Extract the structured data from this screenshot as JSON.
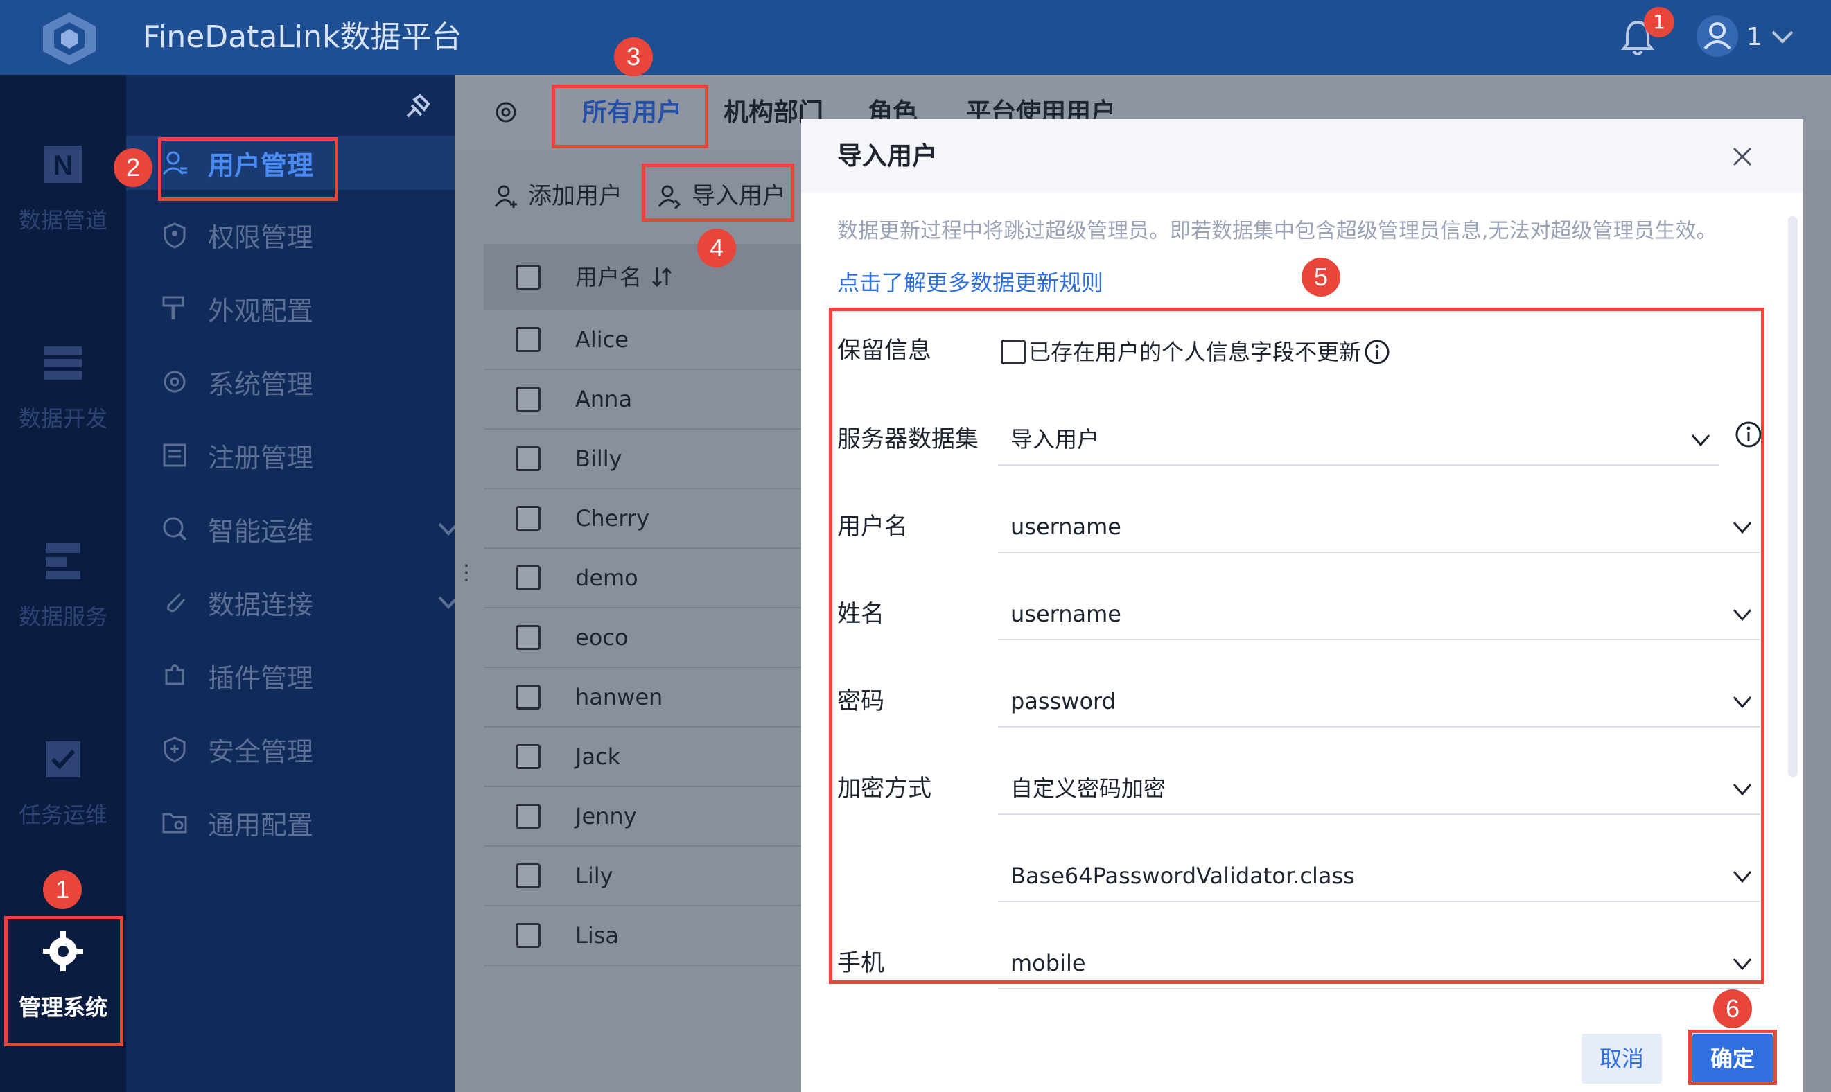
{
  "app": {
    "title": "FineDataLink数据平台",
    "notification_count": "1",
    "user": "1",
    "colors": {
      "header": "#1f4f93",
      "accent": "#2f6fe0",
      "highlight": "#e8463a"
    }
  },
  "leftnav": {
    "items": [
      {
        "label": "数据管道",
        "icon": "pipeline-icon"
      },
      {
        "label": "数据开发",
        "icon": "dev-icon"
      },
      {
        "label": "数据服务",
        "icon": "service-icon"
      },
      {
        "label": "任务运维",
        "icon": "task-icon"
      },
      {
        "label": "管理系统",
        "icon": "gear-icon"
      }
    ]
  },
  "submenu": {
    "items": [
      {
        "label": "用户管理",
        "icon": "user-icon"
      },
      {
        "label": "权限管理",
        "icon": "permission-icon"
      },
      {
        "label": "外观配置",
        "icon": "appearance-icon"
      },
      {
        "label": "系统管理",
        "icon": "system-icon"
      },
      {
        "label": "注册管理",
        "icon": "register-icon"
      },
      {
        "label": "智能运维",
        "icon": "ops-icon"
      },
      {
        "label": "数据连接",
        "icon": "connection-icon"
      },
      {
        "label": "插件管理",
        "icon": "plugin-icon"
      },
      {
        "label": "安全管理",
        "icon": "security-icon"
      },
      {
        "label": "通用配置",
        "icon": "config-icon"
      }
    ]
  },
  "tabs": [
    "所有用户",
    "机构部门",
    "角色",
    "平台使用用户"
  ],
  "toolbar": {
    "add_user": "添加用户",
    "import_user": "导入用户"
  },
  "table": {
    "header": "用户名",
    "rows": [
      "Alice",
      "Anna",
      "Billy",
      "Cherry",
      "demo",
      "eoco",
      "hanwen",
      "Jack",
      "Jenny",
      "Lily",
      "Lisa"
    ]
  },
  "dialog": {
    "title": "导入用户",
    "notice": "数据更新过程中将跳过超级管理员。即若数据集中包含超级管理员信息,无法对超级管理员生效。",
    "link": "点击了解更多数据更新规则",
    "keep_info_label": "保留信息",
    "keep_info_checkbox": "已存在用户的个人信息字段不更新",
    "fields": [
      {
        "label": "服务器数据集",
        "value": "导入用户"
      },
      {
        "label": "用户名",
        "value": "username"
      },
      {
        "label": "姓名",
        "value": "username"
      },
      {
        "label": "密码",
        "value": "password"
      },
      {
        "label": "加密方式",
        "value": "自定义密码加密"
      },
      {
        "label": "",
        "value": "Base64PasswordValidator.class"
      },
      {
        "label": "手机",
        "value": "mobile"
      }
    ],
    "cancel": "取消",
    "ok": "确定"
  },
  "steps": [
    "1",
    "2",
    "3",
    "4",
    "5",
    "6"
  ]
}
